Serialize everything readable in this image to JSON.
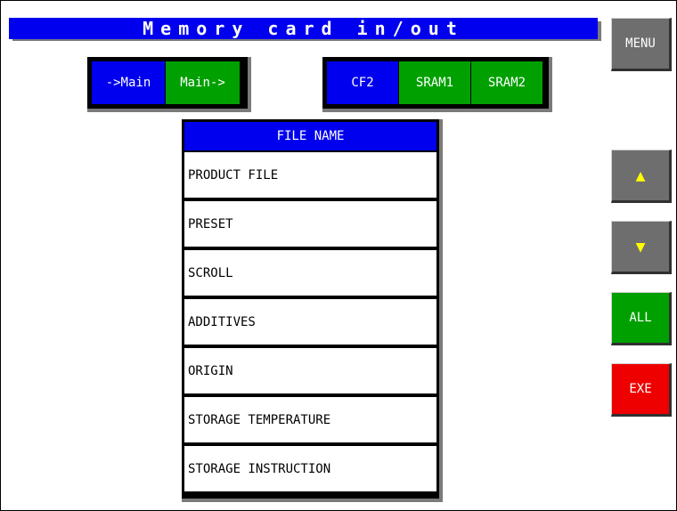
{
  "title": "Memory card in/out",
  "direction": {
    "to_main": "->Main",
    "from_main": "Main->"
  },
  "storage": {
    "cf2": "CF2",
    "sram1": "SRAM1",
    "sram2": "SRAM2"
  },
  "file_list": {
    "header": "FILE NAME",
    "items": [
      "PRODUCT FILE",
      "PRESET",
      "SCROLL",
      "ADDITIVES",
      "ORIGIN",
      "STORAGE TEMPERATURE",
      "STORAGE INSTRUCTION"
    ]
  },
  "side": {
    "menu": "MENU",
    "up_icon": "▲",
    "down_icon": "▼",
    "all": "ALL",
    "exe": "EXE"
  },
  "colors": {
    "blue": "#0000ee",
    "green": "#00a000",
    "red": "#ee0000",
    "yellow_arrow": "#ffff00",
    "gray_button": "#6e6e6e"
  }
}
